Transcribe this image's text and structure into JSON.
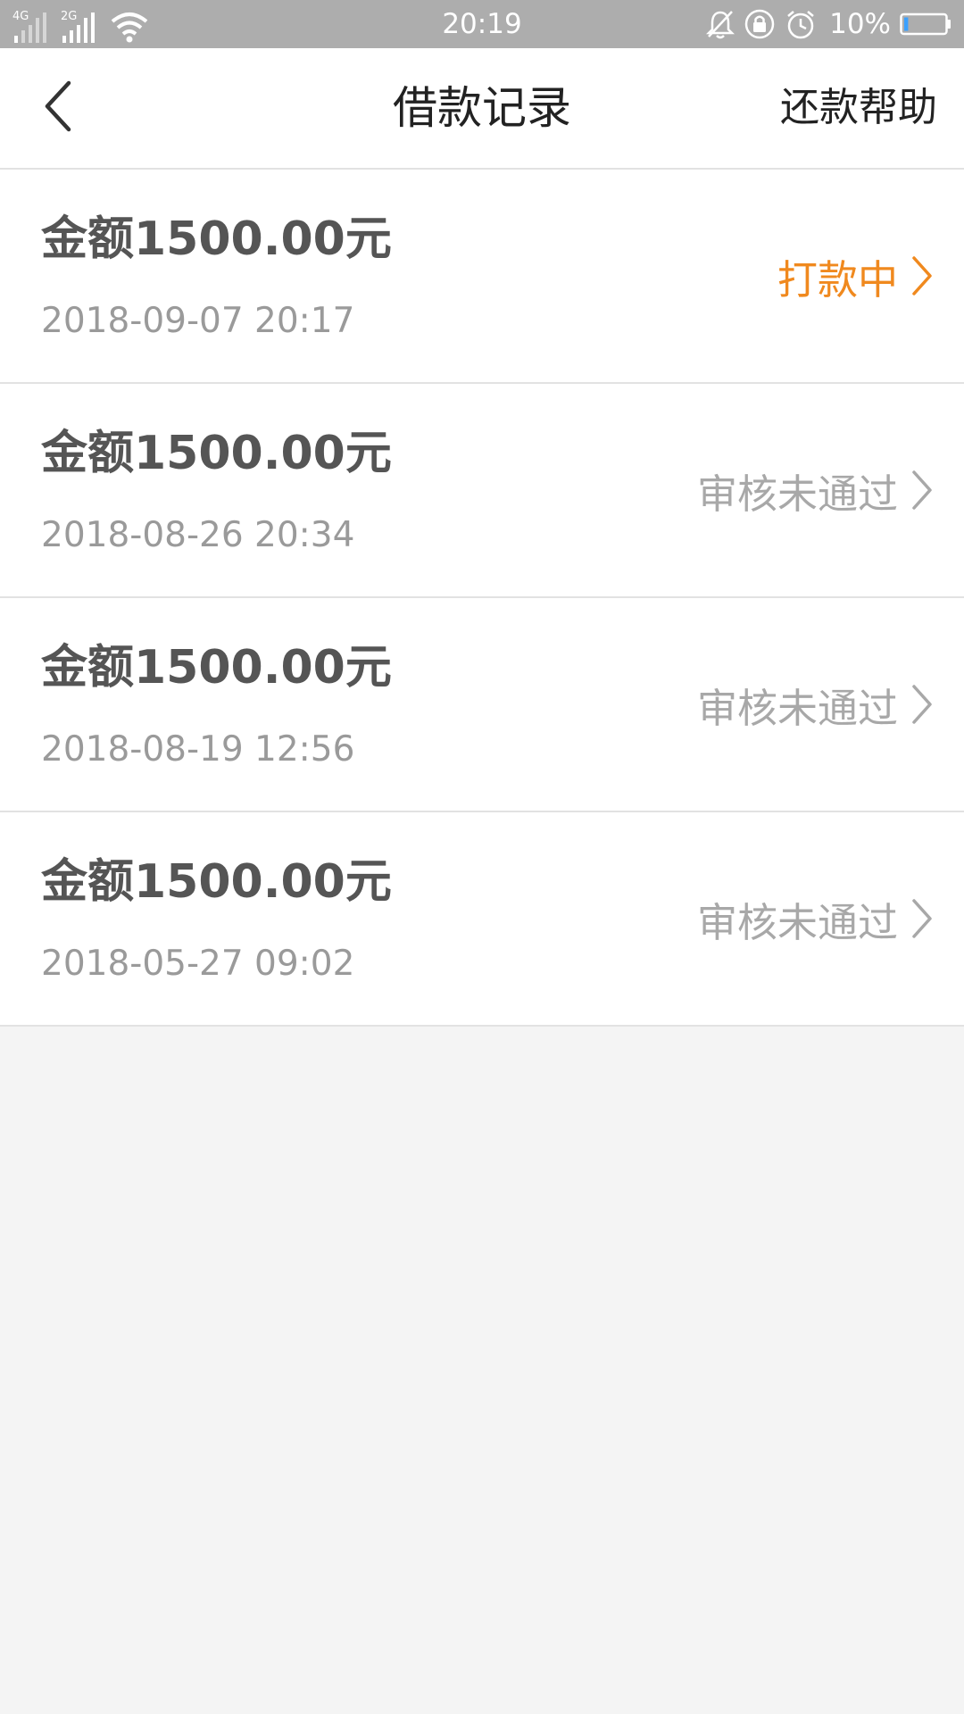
{
  "status_bar": {
    "network_1": "4G",
    "network_2": "2G",
    "time": "20:19",
    "battery_percent": "10%",
    "battery_level": 0.1
  },
  "header": {
    "title": "借款记录",
    "help_label": "还款帮助"
  },
  "colors": {
    "accent_orange": "#f0891e",
    "status_gray": "#a8a8a8",
    "amount_text": "#555555",
    "date_text": "#9a9a9a",
    "page_background": "#f4f4f4",
    "status_bar_background": "#adadad"
  },
  "icons": {
    "back": "chevron-left-icon",
    "row_arrow": "chevron-right-icon",
    "signal": "signal-icon",
    "wifi": "wifi-icon",
    "mute": "bell-mute-icon",
    "rotation_lock": "rotation-lock-icon",
    "alarm": "alarm-clock-icon",
    "battery": "battery-icon"
  },
  "loans": [
    {
      "amount": "金额1500.00元",
      "date": "2018-09-07 20:17",
      "status": "打款中",
      "active": true
    },
    {
      "amount": "金额1500.00元",
      "date": "2018-08-26 20:34",
      "status": "审核未通过",
      "active": false
    },
    {
      "amount": "金额1500.00元",
      "date": "2018-08-19 12:56",
      "status": "审核未通过",
      "active": false
    },
    {
      "amount": "金额1500.00元",
      "date": "2018-05-27 09:02",
      "status": "审核未通过",
      "active": false
    }
  ]
}
